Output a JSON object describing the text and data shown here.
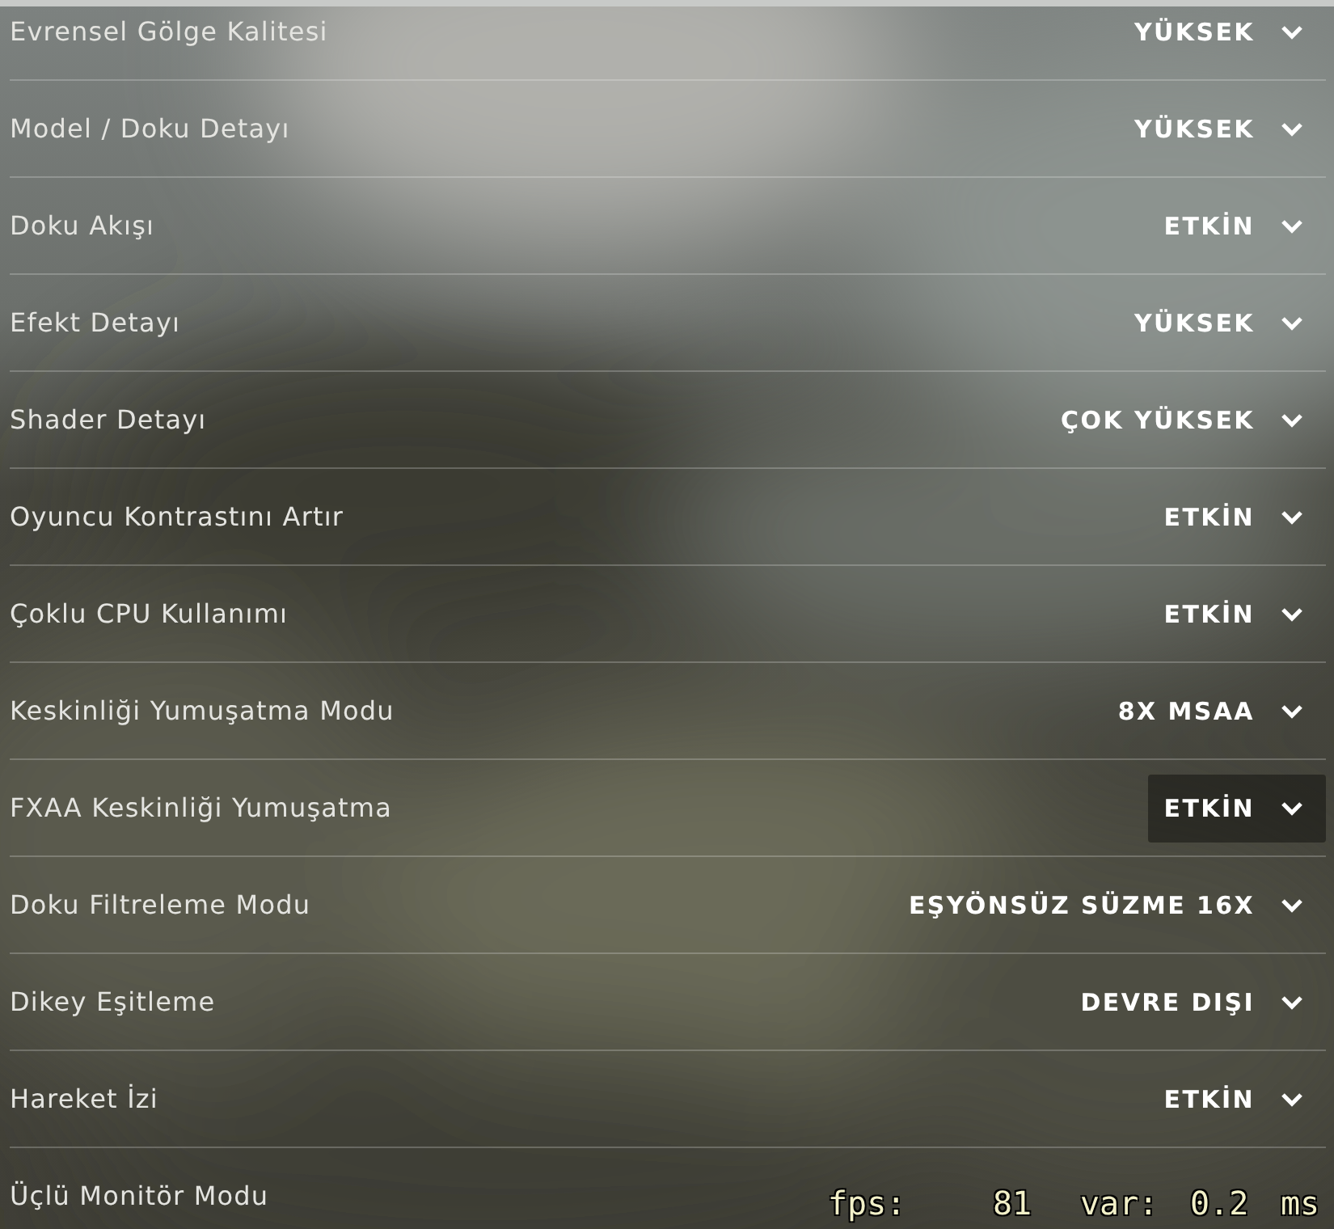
{
  "settings": [
    {
      "label": "Evrensel Gölge Kalitesi",
      "value": "YÜKSEK",
      "highlighted": false
    },
    {
      "label": "Model / Doku Detayı",
      "value": "YÜKSEK",
      "highlighted": false
    },
    {
      "label": "Doku Akışı",
      "value": "ETKİN",
      "highlighted": false
    },
    {
      "label": "Efekt Detayı",
      "value": "YÜKSEK",
      "highlighted": false
    },
    {
      "label": "Shader Detayı",
      "value": "ÇOK YÜKSEK",
      "highlighted": false
    },
    {
      "label": "Oyuncu Kontrastını Artır",
      "value": "ETKİN",
      "highlighted": false
    },
    {
      "label": "Çoklu CPU Kullanımı",
      "value": "ETKİN",
      "highlighted": false
    },
    {
      "label": "Keskinliği Yumuşatma Modu",
      "value": "8X MSAA",
      "highlighted": false
    },
    {
      "label": "FXAA Keskinliği Yumuşatma",
      "value": "ETKİN",
      "highlighted": true
    },
    {
      "label": "Doku Filtreleme Modu",
      "value": "EŞYÖNSÜZ SÜZME 16X",
      "highlighted": false
    },
    {
      "label": "Dikey Eşitleme",
      "value": "DEVRE DIŞI",
      "highlighted": false
    },
    {
      "label": "Hareket İzi",
      "value": "ETKİN",
      "highlighted": false
    },
    {
      "label": "Üçlü Monitör Modu"
    }
  ],
  "fps_overlay": {
    "fps_label": "fps:",
    "fps": "81",
    "var_label": "var:",
    "var": "0.2",
    "unit": "ms"
  }
}
